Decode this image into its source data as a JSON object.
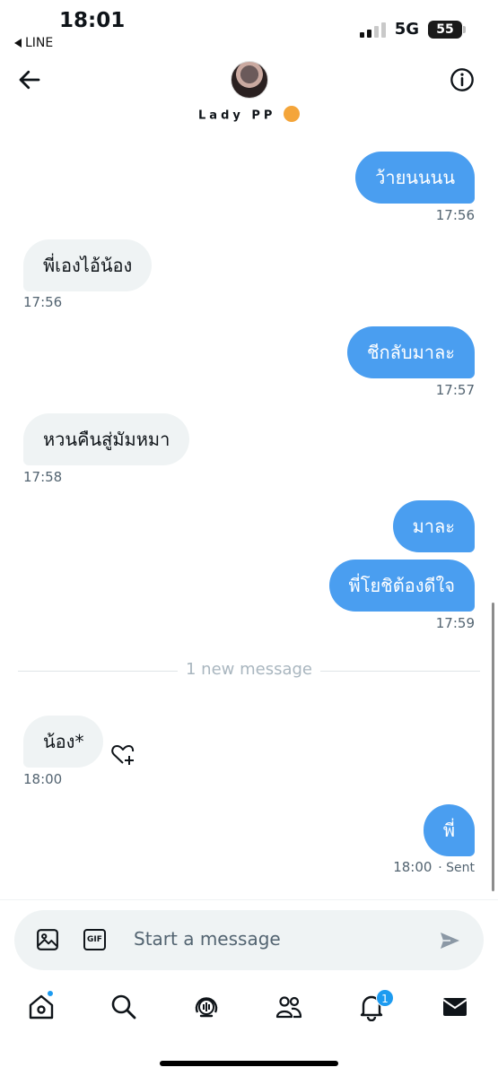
{
  "status_bar": {
    "time": "18:01",
    "back_app": "LINE",
    "network": "5G",
    "battery": "55"
  },
  "header": {
    "contact_name": "Lady PP",
    "back_icon": "arrow-left-icon",
    "info_icon": "info-circle-icon"
  },
  "messages": [
    {
      "direction": "out",
      "text": "ว้ายนนนน",
      "time": "17:56"
    },
    {
      "direction": "in",
      "text": "พี่เองไอ้น้อง",
      "time": "17:56"
    },
    {
      "direction": "out",
      "text": "ชีกลับมาละ",
      "time": "17:57"
    },
    {
      "direction": "in",
      "text": "หวนคืนสู่มัมหมา",
      "time": "17:58"
    },
    {
      "direction": "out",
      "text": "มาละ",
      "time": ""
    },
    {
      "direction": "out",
      "text": "พี่โยชิต้องดีใจ",
      "time": "17:59"
    },
    {
      "direction": "in",
      "text": "น้อง*",
      "time": "18:00"
    },
    {
      "direction": "out",
      "text": "พี่",
      "time": "18:00",
      "status": "· Sent"
    }
  ],
  "divider": {
    "text": "1 new message"
  },
  "composer": {
    "placeholder": "Start a message",
    "gif_label": "GIF",
    "icons": [
      "image-icon",
      "gif-icon",
      "send-icon"
    ]
  },
  "tab_bar": {
    "items": [
      "home-icon",
      "search-icon",
      "spaces-icon",
      "communities-icon",
      "notifications-icon",
      "messages-icon"
    ],
    "notifications_count": "1"
  },
  "colors": {
    "outgoing_bubble": "#4a9ef0",
    "incoming_bubble": "#eff3f4",
    "accent": "#1d9bf0"
  }
}
